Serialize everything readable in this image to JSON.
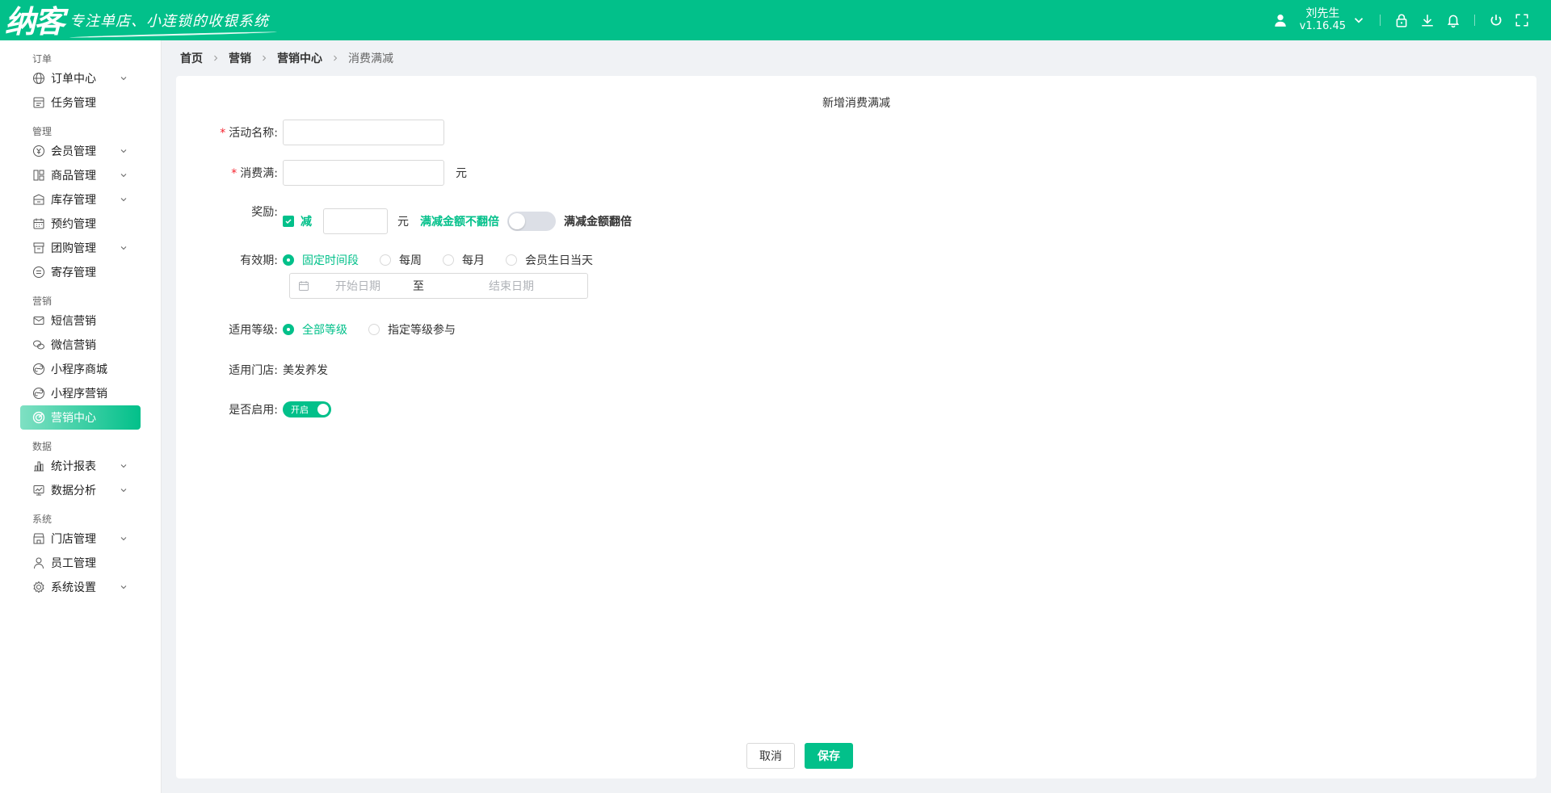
{
  "header": {
    "logo_text": "纳客",
    "slogan": "专注单店、小连锁的收银系统",
    "user_name": "刘先生",
    "version": "v1.16.45",
    "bg_color": "#02c08a"
  },
  "sidebar": {
    "groups": [
      {
        "title": "订单",
        "items": [
          {
            "label": "订单中心",
            "icon": "globe-icon",
            "has_children": true
          },
          {
            "label": "任务管理",
            "icon": "task-icon",
            "has_children": false
          }
        ]
      },
      {
        "title": "管理",
        "items": [
          {
            "label": "会员管理",
            "icon": "member-icon",
            "has_children": true
          },
          {
            "label": "商品管理",
            "icon": "goods-icon",
            "has_children": true
          },
          {
            "label": "库存管理",
            "icon": "inventory-icon",
            "has_children": true
          },
          {
            "label": "预约管理",
            "icon": "calendar-icon",
            "has_children": false
          },
          {
            "label": "团购管理",
            "icon": "groupbuy-icon",
            "has_children": true
          },
          {
            "label": "寄存管理",
            "icon": "storage-icon",
            "has_children": false
          }
        ]
      },
      {
        "title": "营销",
        "items": [
          {
            "label": "短信营销",
            "icon": "mail-icon",
            "has_children": false
          },
          {
            "label": "微信营销",
            "icon": "wechat-icon",
            "has_children": false
          },
          {
            "label": "小程序商城",
            "icon": "miniapp-icon",
            "has_children": false
          },
          {
            "label": "小程序营销",
            "icon": "miniapp-icon",
            "has_children": false
          },
          {
            "label": "营销中心",
            "icon": "target-icon",
            "has_children": false,
            "active": true
          }
        ]
      },
      {
        "title": "数据",
        "items": [
          {
            "label": "统计报表",
            "icon": "bar-chart-icon",
            "has_children": true
          },
          {
            "label": "数据分析",
            "icon": "monitor-icon",
            "has_children": true
          }
        ]
      },
      {
        "title": "系统",
        "items": [
          {
            "label": "门店管理",
            "icon": "store-icon",
            "has_children": true
          },
          {
            "label": "员工管理",
            "icon": "user-icon",
            "has_children": false
          },
          {
            "label": "系统设置",
            "icon": "gear-icon",
            "has_children": true
          }
        ]
      }
    ]
  },
  "breadcrumb": [
    "首页",
    "营销",
    "营销中心",
    "消费满减"
  ],
  "form": {
    "title": "新增消费满减",
    "activity_name": {
      "label": "活动名称:",
      "value": ""
    },
    "spend_threshold": {
      "label": "消费满:",
      "value": "",
      "unit": "元"
    },
    "reward": {
      "label": "奖励:",
      "checkbox_label": "减",
      "value": "",
      "unit": "元",
      "toggle_off_label": "满减金额不翻倍",
      "toggle_on_label": "满减金额翻倍"
    },
    "validity": {
      "label": "有效期:",
      "options": [
        "固定时间段",
        "每周",
        "每月",
        "会员生日当天"
      ],
      "selected": "固定时间段",
      "start_placeholder": "开始日期",
      "separator": "至",
      "end_placeholder": "结束日期"
    },
    "level": {
      "label": "适用等级:",
      "options": [
        "全部等级",
        "指定等级参与"
      ],
      "selected": "全部等级"
    },
    "store": {
      "label": "适用门店:",
      "value": "美发养发"
    },
    "enabled": {
      "label": "是否启用:",
      "toggle_text": "开启"
    },
    "cancel_label": "取消",
    "save_label": "保存"
  }
}
